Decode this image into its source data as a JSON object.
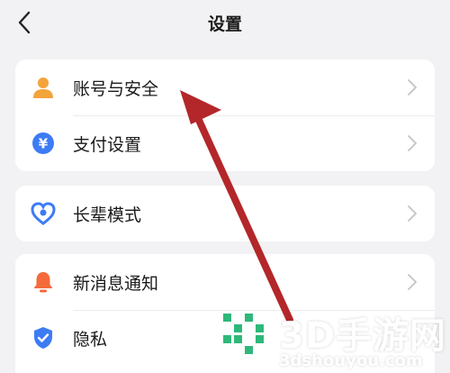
{
  "header": {
    "title": "设置",
    "back_icon": "chevron-left-icon"
  },
  "groups": [
    {
      "items": [
        {
          "label": "账号与安全",
          "icon": "user-icon",
          "icon_color": "#f3a43b"
        },
        {
          "label": "支付设置",
          "icon": "yuan-icon",
          "icon_color": "#3d7bf5"
        }
      ]
    },
    {
      "items": [
        {
          "label": "长辈模式",
          "icon": "heart-icon",
          "icon_color": "#3d7bf5"
        }
      ]
    },
    {
      "items": [
        {
          "label": "新消息通知",
          "icon": "bell-icon",
          "icon_color": "#f46a3b"
        },
        {
          "label": "隐私",
          "icon": "shield-icon",
          "icon_color": "#3d7bf5"
        }
      ]
    }
  ],
  "watermark": {
    "main": "3D手游网",
    "sub": "3dshouyou.com",
    "logo": "3d-logo-icon"
  },
  "colors": {
    "annotation_arrow": "#b3272a",
    "watermark_green": "#2fb87a"
  }
}
